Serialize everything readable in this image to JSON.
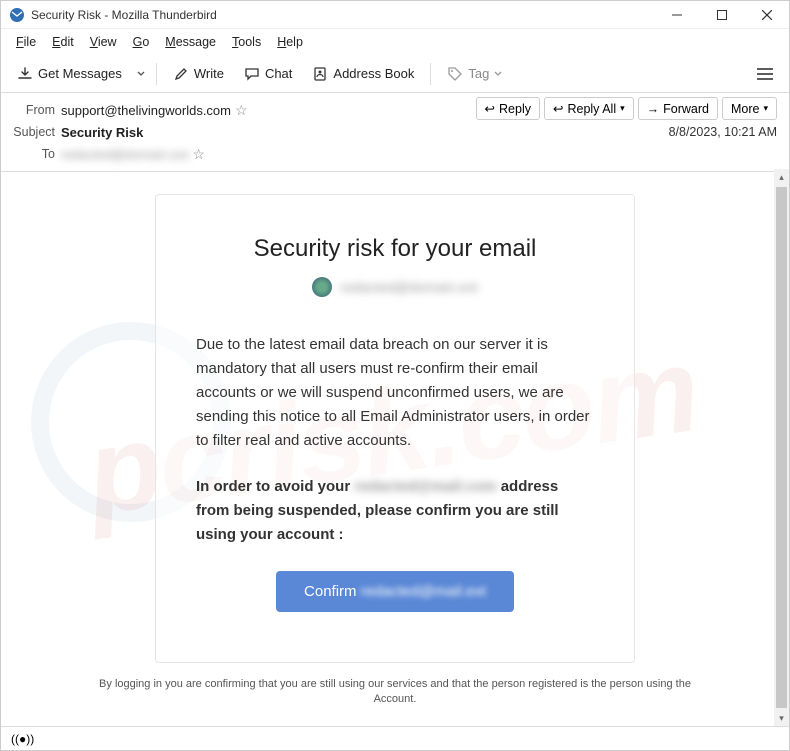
{
  "titlebar": {
    "text": "Security Risk - Mozilla Thunderbird"
  },
  "menu": {
    "file": "File",
    "edit": "Edit",
    "view": "View",
    "go": "Go",
    "message": "Message",
    "tools": "Tools",
    "help": "Help"
  },
  "toolbar": {
    "get_messages": "Get Messages",
    "write": "Write",
    "chat": "Chat",
    "address_book": "Address Book",
    "tag": "Tag"
  },
  "header": {
    "from_label": "From",
    "from_value": "support@thelivingworlds.com",
    "subject_label": "Subject",
    "subject_value": "Security Risk",
    "to_label": "To",
    "to_value_redacted": "redacted@domain.ext",
    "date": "8/8/2023, 10:21 AM",
    "reply": "Reply",
    "reply_all": "Reply All",
    "forward": "Forward",
    "more": "More"
  },
  "email": {
    "title": "Security risk for your email",
    "recipient_redacted": "redacted@domain.ext",
    "para1": "Due to the latest email data breach on our server it is mandatory that all users must re-confirm their email accounts or we will suspend unconfirmed users, we are sending this notice to all Email Administrator users, in order to filter real and active accounts.",
    "bold_prefix": "In order to avoid your ",
    "bold_mid_redacted": "redacted@mail.com",
    "bold_suffix": " address from being suspended, please confirm you are still using your account :",
    "confirm_label": "Confirm",
    "confirm_redacted": "redacted@mail.ext",
    "footer": "By logging in you are confirming that you are still using our services and that the person registered is the person using the Account."
  },
  "watermark": {
    "text": "pcrisk.com"
  }
}
